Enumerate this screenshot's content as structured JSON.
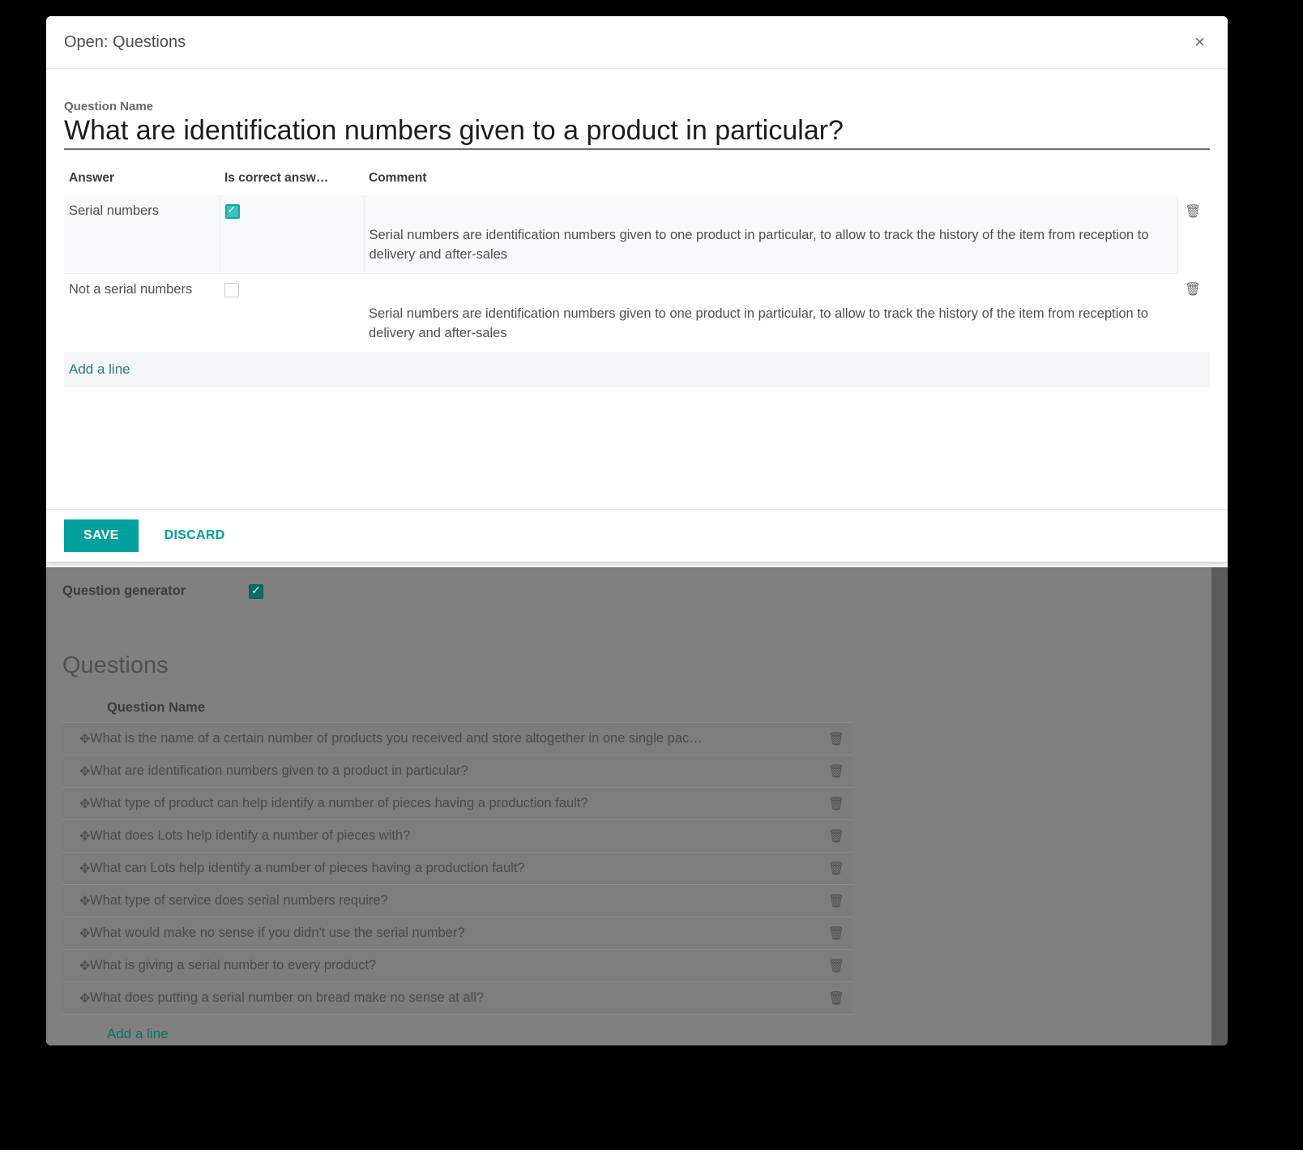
{
  "modal": {
    "title": "Open: Questions",
    "close_label": "×",
    "field_label": "Question Name",
    "field_value": "What are identification numbers given to a product in particular?",
    "field_placeholder": "Question Name",
    "answers_table": {
      "columns": [
        "Answer",
        "Is correct answ…",
        "Comment"
      ],
      "rows": [
        {
          "answer": "Serial numbers",
          "is_correct": true,
          "comment": "Serial numbers are identification numbers given to one product in particular, to allow to track the history of the item from reception to delivery and after-sales",
          "delete_icon": "trash-icon",
          "selected": true
        },
        {
          "answer": "Not a serial numbers",
          "is_correct": false,
          "comment": "Serial numbers are identification numbers given to one product in particular, to allow to track the history of the item from reception to delivery and after-sales",
          "delete_icon": "trash-icon",
          "selected": false
        }
      ],
      "add_line_label": "Add a line"
    },
    "save_label": "SAVE",
    "discard_label": "DISCARD"
  },
  "background": {
    "question_generator_label": "Question generator",
    "question_generator_checked": true,
    "questions_heading": "Questions",
    "questions_column_header": "Question Name",
    "questions": [
      {
        "text": "What is the name of a certain number of products you received and store altogether in one single pac…"
      },
      {
        "text": "What are identification numbers given to a product in particular?"
      },
      {
        "text": "What type of product can help identify a number of pieces having a production fault?"
      },
      {
        "text": "What does Lots help identify a number of pieces with?"
      },
      {
        "text": "What can Lots help identify a number of pieces having a production fault?"
      },
      {
        "text": "What type of service does serial numbers require?"
      },
      {
        "text": "What would make no sense if you didn't use the serial number?"
      },
      {
        "text": "What is giving a serial number to every product?"
      },
      {
        "text": "What does putting a serial number on bread make no sense at all?"
      }
    ],
    "add_line_label": "Add a line",
    "drag_icon": "✥",
    "trash_icon": "🗑"
  },
  "colors": {
    "accent": "#00A09D",
    "checkbox_checked": "#3dc0b8",
    "dim_overlay": "#808080",
    "link": "#0b6e66"
  }
}
